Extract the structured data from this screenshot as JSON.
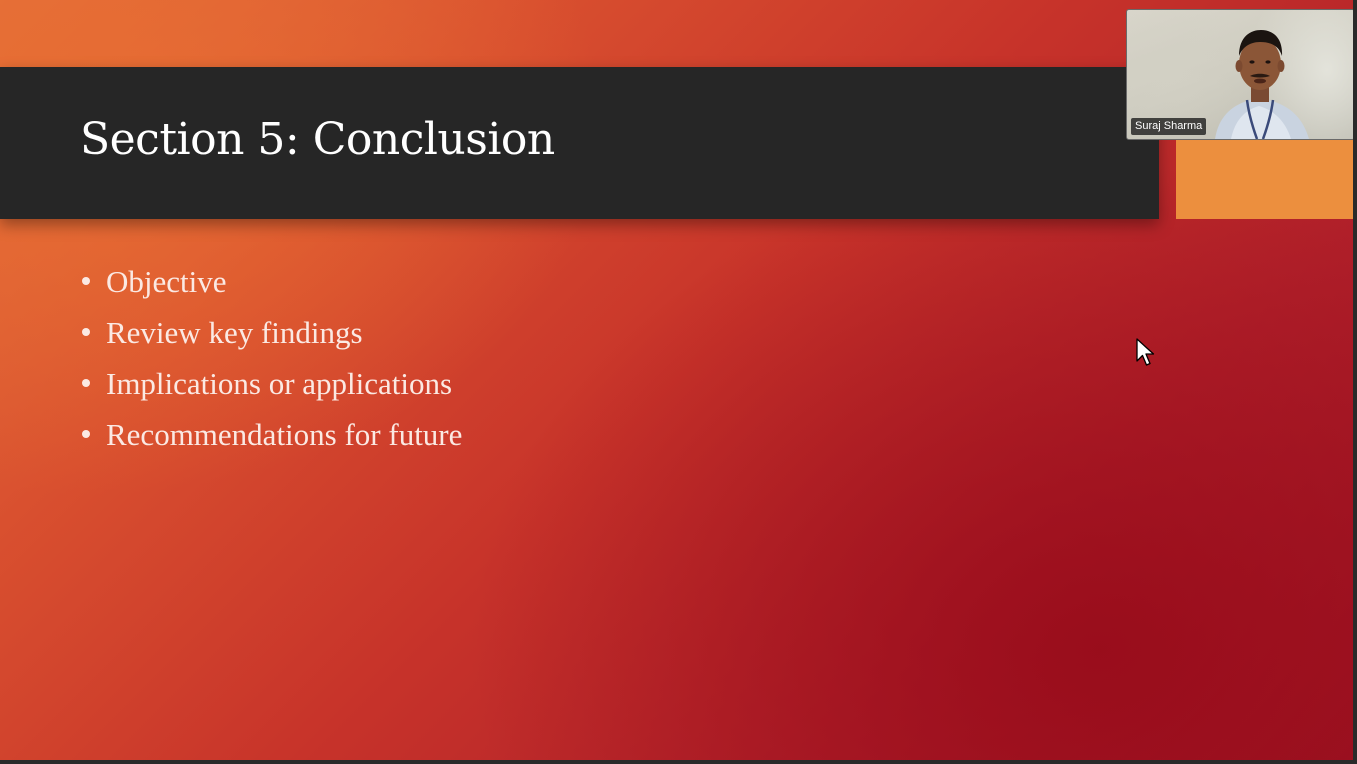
{
  "slide": {
    "title": "Section 5: Conclusion",
    "bullets": [
      "Objective",
      "Review key findings",
      "Implications or applications",
      "Recommendations for future"
    ]
  },
  "video": {
    "participant_name": "Suraj Sharma"
  },
  "colors": {
    "title_band": "#262626",
    "accent": "#ec8f3e",
    "background_start": "#e4703c",
    "background_end": "#9e1424",
    "text": "#fbe9e3"
  },
  "icons": {
    "cursor": "mouse-pointer-icon"
  }
}
